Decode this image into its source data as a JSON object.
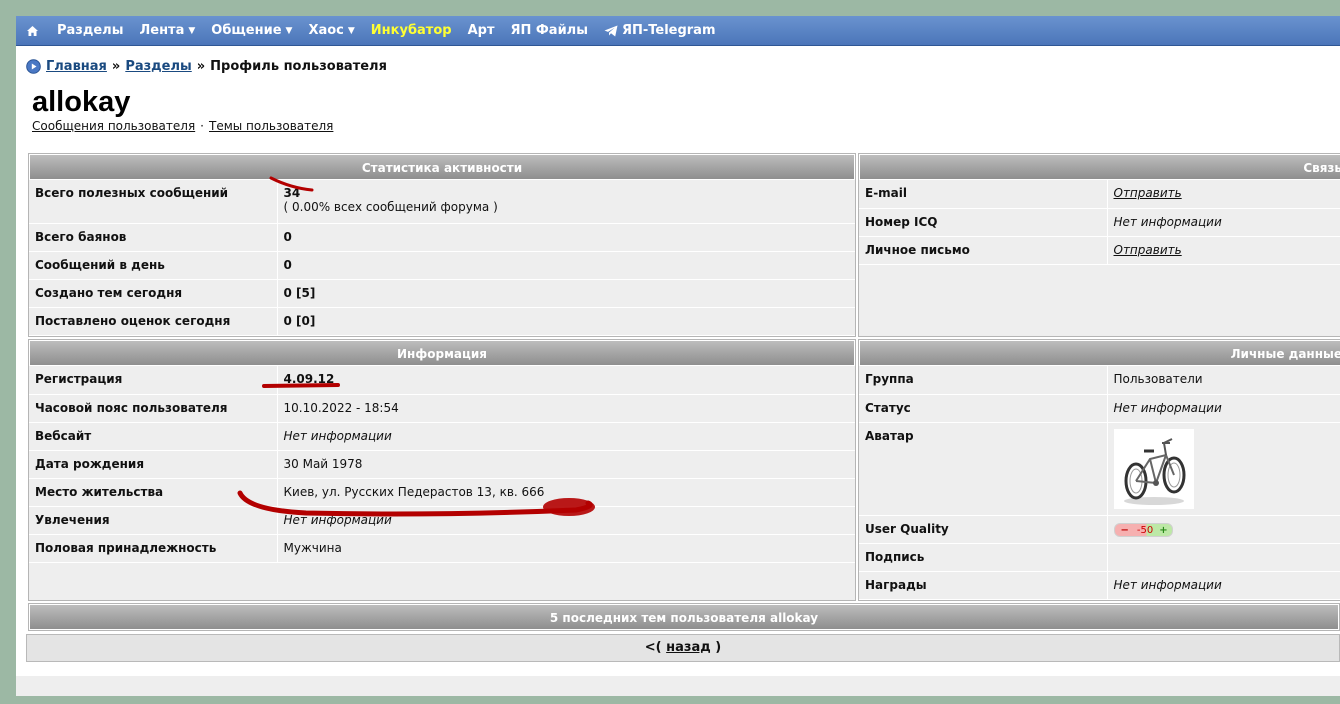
{
  "nav": {
    "home_icon": "home-icon",
    "items": [
      {
        "label": "Разделы",
        "dropdown": false,
        "highlight": false
      },
      {
        "label": "Лента",
        "dropdown": true,
        "highlight": false
      },
      {
        "label": "Общение",
        "dropdown": true,
        "highlight": false
      },
      {
        "label": "Хаос",
        "dropdown": true,
        "highlight": false
      },
      {
        "label": "Инкубатор",
        "dropdown": false,
        "highlight": true
      },
      {
        "label": "Арт",
        "dropdown": false,
        "highlight": false
      },
      {
        "label": "ЯП Файлы",
        "dropdown": false,
        "highlight": false
      },
      {
        "label": "ЯП-Telegram",
        "dropdown": false,
        "highlight": false,
        "icon": "telegram-icon"
      }
    ]
  },
  "breadcrumb": {
    "home": "Главная",
    "sep": "»",
    "sections": "Разделы",
    "current": "Профиль пользователя"
  },
  "user": {
    "name": "allokay",
    "messages_link": "Сообщения пользователя",
    "dot": "·",
    "topics_link": "Темы пользователя"
  },
  "activity": {
    "title": "Статистика активности",
    "rows": [
      {
        "label": "Всего полезных сообщений",
        "value": "34",
        "sub": "( 0.00% всех сообщений форума )"
      },
      {
        "label": "Всего баянов",
        "value": "0"
      },
      {
        "label": "Сообщений в день",
        "value": "0"
      },
      {
        "label": "Создано тем сегодня",
        "value": "0 [5]"
      },
      {
        "label": "Поставлено оценок сегодня",
        "value": "0 [0]"
      }
    ]
  },
  "contact": {
    "title": "Связь",
    "rows": [
      {
        "label": "E-mail",
        "value": "Отправить",
        "link": true
      },
      {
        "label": "Номер ICQ",
        "value": "Нет информации",
        "link": false
      },
      {
        "label": "Личное письмо",
        "value": "Отправить",
        "link": true
      }
    ]
  },
  "info": {
    "title": "Информация",
    "rows": [
      {
        "label": "Регистрация",
        "value": "4.09.12",
        "bold": true
      },
      {
        "label": "Часовой пояс пользователя",
        "value": "10.10.2022 - 18:54"
      },
      {
        "label": "Вебсайт",
        "value": "Нет информации",
        "italic": true
      },
      {
        "label": "Дата рождения",
        "value": "30 Май 1978"
      },
      {
        "label": "Место жительства",
        "value": "Киев, ул. Русских Педерастов 13, кв. 666"
      },
      {
        "label": "Увлечения",
        "value": "Нет информации",
        "italic": true
      },
      {
        "label": "Половая принадлежность",
        "value": "Мужчина"
      }
    ]
  },
  "personal": {
    "title": "Личные данные",
    "group_label": "Группа",
    "group_value": "Пользователи",
    "status_label": "Статус",
    "status_value": "Нет информации",
    "avatar_label": "Аватар",
    "avatar_icon": "bicycle-icon",
    "quality_label": "User Quality",
    "quality_minus": "−",
    "quality_value": "-50",
    "quality_plus": "+",
    "signature_label": "Подпись",
    "signature_value": "",
    "awards_label": "Награды",
    "awards_value": "Нет информации"
  },
  "recent": {
    "title": "5 последних тем пользователя allokay"
  },
  "back": {
    "open": "<(",
    "link": "назад",
    "close": ")"
  },
  "colors": {
    "nav_bg": "#5a84c4",
    "nav_highlight": "#ffff33",
    "link": "#1a4a80",
    "panel_bg": "#eeeeee",
    "header_grad": "#9e9e9e",
    "scribble": "#b30000"
  }
}
